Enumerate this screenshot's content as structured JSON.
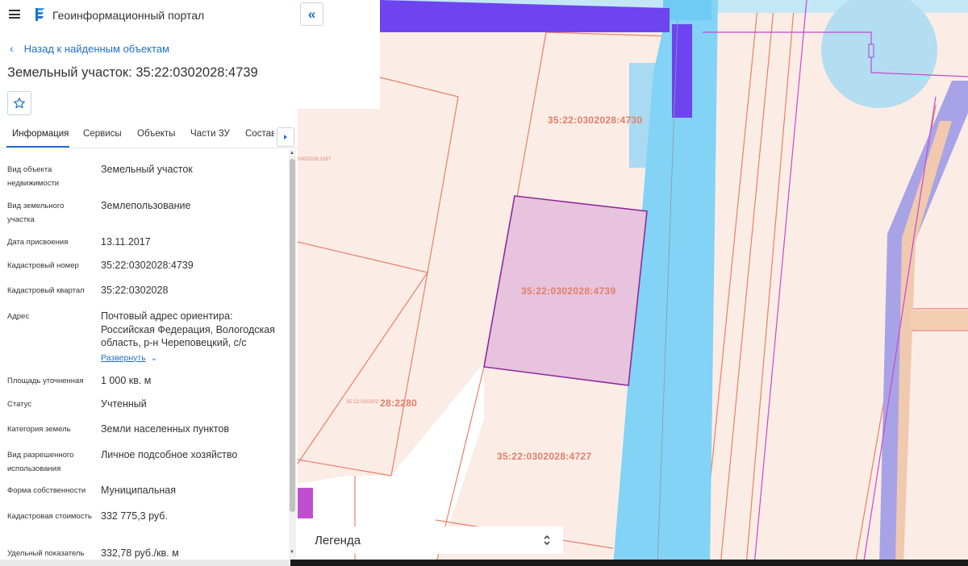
{
  "header": {
    "title": "Геоинформационный портал",
    "menu_icon": "hamburger-menu-icon",
    "logo_icon": "portal-logo-icon"
  },
  "back_link": {
    "label": "Назад к найденным объектам",
    "icon": "chevron-left-icon"
  },
  "object_title": "Земельный участок: 35:22:0302028:4739",
  "favorite_icon": "star-icon",
  "tabs": [
    {
      "label": "Информация",
      "active": true
    },
    {
      "label": "Сервисы"
    },
    {
      "label": "Объекты"
    },
    {
      "label": "Части ЗУ"
    },
    {
      "label": "Состав"
    }
  ],
  "properties": [
    {
      "label": "Вид объекта недвижимости",
      "value": "Земельный участок"
    },
    {
      "label": "Вид земельного участка",
      "value": "Землепользование"
    },
    {
      "label": "Дата присвоения",
      "value": "13.11.2017"
    },
    {
      "label": "Кадастровый номер",
      "value": "35:22:0302028:4739"
    },
    {
      "label": "Кадастровый квартал",
      "value": "35:22:0302028"
    },
    {
      "label": "Адрес",
      "value": "Почтовый адрес ориентира: Российская Федерация, Вологодская область, р-н Череповецкий, с/с",
      "expand_label": "Развернуть"
    },
    {
      "label": "Площадь уточненная",
      "value": "1 000 кв. м"
    },
    {
      "label": "Статус",
      "value": "Учтенный"
    },
    {
      "label": "Категория земель",
      "value": "Земли населенных пунктов"
    },
    {
      "label": "Вид разрешенного использования",
      "value": "Личное подсобное хозяйство"
    },
    {
      "label": "Форма собственности",
      "value": "Муниципальная"
    },
    {
      "label": "Кадастровая стоимость",
      "value": "332 775,3 руб."
    },
    {
      "label": "Удельный показатель",
      "value": "332,78 руб./кв. м"
    }
  ],
  "map": {
    "parcel_labels": {
      "p4730": "35:22:0302028:4730",
      "p4739": "35:22:0302028:4739",
      "p4727": "35:22:0302028:4727",
      "p2280": "28:2280",
      "p2280_small": "35:22:030202",
      "p1187_small": "0302028:1187"
    },
    "colors": {
      "parcel_fill": "#fbece6",
      "parcel_line": "#e8806a",
      "selected_fill": "#e8c3de",
      "selected_line": "#8e2b9a",
      "road_blue": "#82d3f5",
      "road_purple": "#6e44f0",
      "road_lavender": "#a8a3e6"
    }
  },
  "legend": {
    "label": "Легенда"
  },
  "collapse_icon": "double-chevron-left-icon"
}
